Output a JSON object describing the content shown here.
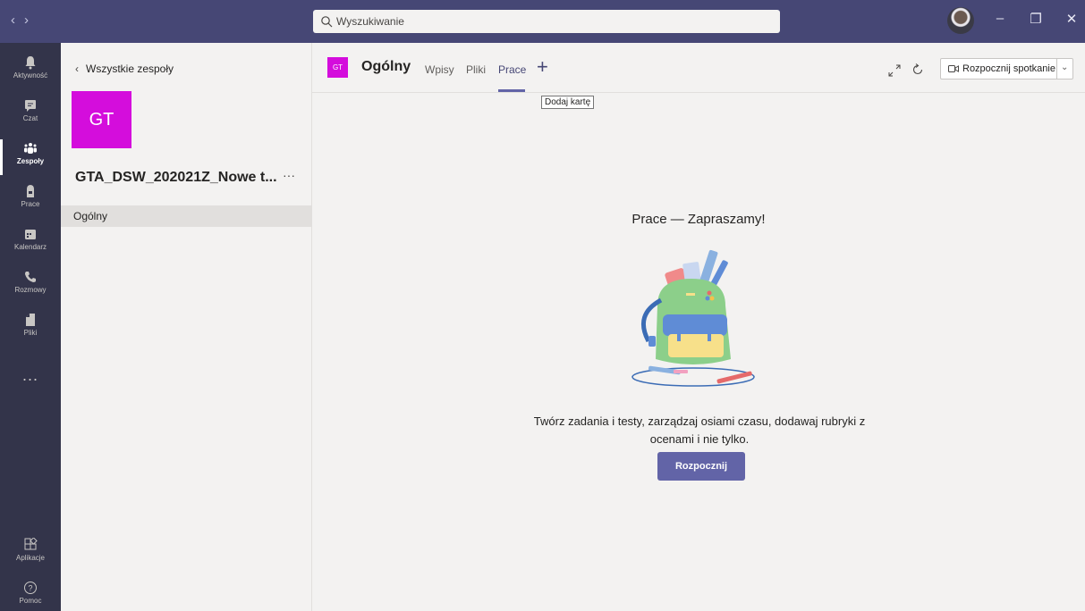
{
  "titlebar": {
    "nav_back": "‹",
    "nav_forward": "›",
    "search_placeholder": "Wyszukiwanie",
    "window_buttons": [
      "minimize",
      "restore",
      "close"
    ]
  },
  "rail": {
    "items": [
      {
        "label": "Aktywność",
        "icon": "bell-icon",
        "active": false
      },
      {
        "label": "Czat",
        "icon": "chat-icon",
        "active": false
      },
      {
        "label": "Zespoły",
        "icon": "teams-icon",
        "active": true
      },
      {
        "label": "Prace",
        "icon": "assignments-icon",
        "active": false
      },
      {
        "label": "Kalendarz",
        "icon": "calendar-icon",
        "active": false
      },
      {
        "label": "Rozmowy",
        "icon": "phone-icon",
        "active": false
      },
      {
        "label": "Pliki",
        "icon": "file-icon",
        "active": false
      }
    ],
    "more": "...",
    "bottom": [
      {
        "label": "Aplikacje",
        "icon": "apps-icon"
      },
      {
        "label": "Pomoc",
        "icon": "help-icon"
      }
    ]
  },
  "team_panel": {
    "back_label": "Wszystkie zespoły",
    "tile_initials": "GT",
    "team_name": "GTA_DSW_202021Z_Nowe t...",
    "more": "···",
    "channels": [
      "Ogólny"
    ]
  },
  "header": {
    "tile_initials": "GT",
    "channel_title": "Ogólny",
    "tabs": [
      "Wpisy",
      "Pliki",
      "Prace"
    ],
    "active_tab": "Prace",
    "add_tab": "+",
    "tooltip": "Dodaj kartę",
    "meet_button": "Rozpocznij spotkanie"
  },
  "main": {
    "welcome_title": "Prace — Zapraszamy!",
    "description_line1": "Twórz zadania i testy, zarządzaj osiami czasu, dodawaj rubryki z",
    "description_line2": "ocenami i nie tylko.",
    "start_button": "Rozpocznij"
  },
  "colors": {
    "titlebar": "#464775",
    "rail": "#33344a",
    "accent": "#6264a7",
    "team_tile": "#d40ddc"
  }
}
